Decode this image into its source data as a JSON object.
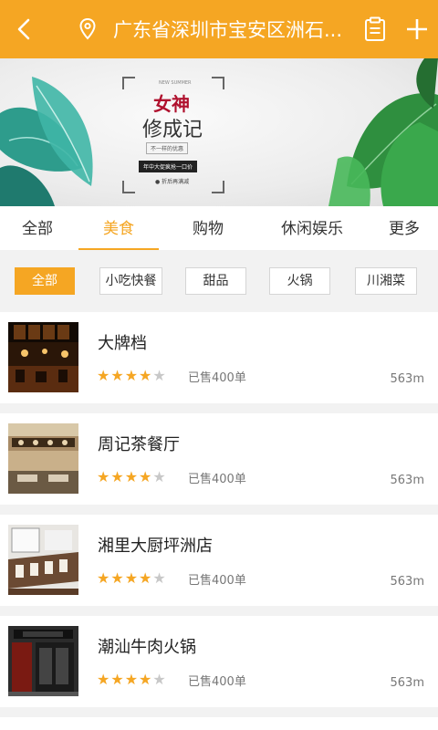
{
  "header": {
    "address": "广东省深圳市宝安区洲石...",
    "icons": [
      "back-arrow-icon",
      "location-pin-icon",
      "clipboard-icon",
      "plus-icon"
    ]
  },
  "banner": {
    "title_line1": "女神",
    "title_line2": "修成记",
    "english": "NEW SUMMER",
    "tagline": "不一样的优惠",
    "promo": "年中大促疯抢一口价",
    "note": "● 折后再满减"
  },
  "tabs": [
    {
      "label": "全部"
    },
    {
      "label": "美食"
    },
    {
      "label": "购物"
    },
    {
      "label": "休闲娱乐"
    },
    {
      "label": "更多"
    }
  ],
  "active_tab": "美食",
  "filters": [
    {
      "label": "全部"
    },
    {
      "label": "小吃快餐"
    },
    {
      "label": "甜品"
    },
    {
      "label": "火锅"
    },
    {
      "label": "川湘菜"
    }
  ],
  "active_filter": "全部",
  "items": [
    {
      "name": "大牌档",
      "rating": 4,
      "rating_max": 5,
      "sold": "已售400单",
      "distance": "563m"
    },
    {
      "name": "周记茶餐厅",
      "rating": 4,
      "rating_max": 5,
      "sold": "已售400单",
      "distance": "563m"
    },
    {
      "name": "湘里大厨坪洲店",
      "rating": 4,
      "rating_max": 5,
      "sold": "已售400单",
      "distance": "563m"
    },
    {
      "name": "潮汕牛肉火锅",
      "rating": 4,
      "rating_max": 5,
      "sold": "已售400单",
      "distance": "563m"
    }
  ],
  "colors": {
    "accent": "#f5a623",
    "star_off": "#c8c8c8"
  }
}
